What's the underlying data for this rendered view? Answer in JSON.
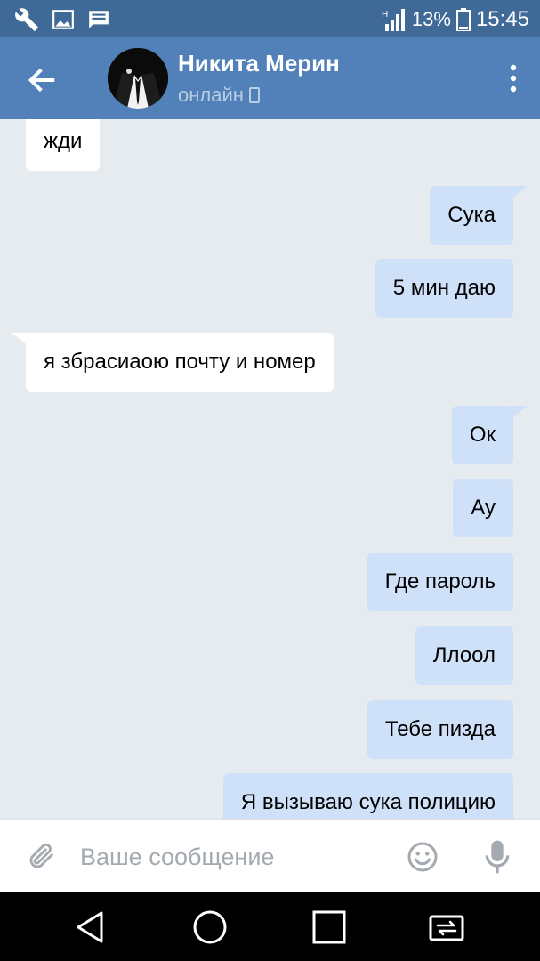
{
  "status_bar": {
    "icons_left": [
      "wrench-icon",
      "image-icon",
      "message-icon"
    ],
    "network": "H",
    "battery_percent": "13%",
    "time": "15:45"
  },
  "header": {
    "contact_name": "Никита Мерин",
    "status": "онлайн",
    "status_icon": "mobile-icon"
  },
  "messages": [
    {
      "text": "жди",
      "direction": "incoming"
    },
    {
      "text": "Сука",
      "direction": "outgoing"
    },
    {
      "text": "5 мин даю",
      "direction": "outgoing"
    },
    {
      "text": "я збрасиаою почту и номер",
      "direction": "incoming"
    },
    {
      "text": "Ок",
      "direction": "outgoing"
    },
    {
      "text": "Ау",
      "direction": "outgoing"
    },
    {
      "text": "Где пароль",
      "direction": "outgoing"
    },
    {
      "text": "Ллоол",
      "direction": "outgoing"
    },
    {
      "text": "Тебе пизда",
      "direction": "outgoing"
    },
    {
      "text": "Я вызываю сука полицию",
      "direction": "outgoing"
    }
  ],
  "composer": {
    "placeholder": "Ваше сообщение",
    "icons": [
      "attach-icon",
      "emoji-icon",
      "mic-icon"
    ]
  },
  "nav_bar": {
    "buttons": [
      "back-triangle-icon",
      "home-circle-icon",
      "recents-square-icon",
      "switch-icon"
    ]
  },
  "colors": {
    "status_bar": "#3f6a98",
    "app_bar": "#5181b8",
    "chat_background": "#e6ebf0",
    "incoming_bubble": "#ffffff",
    "outgoing_bubble": "#cfe1f8"
  }
}
